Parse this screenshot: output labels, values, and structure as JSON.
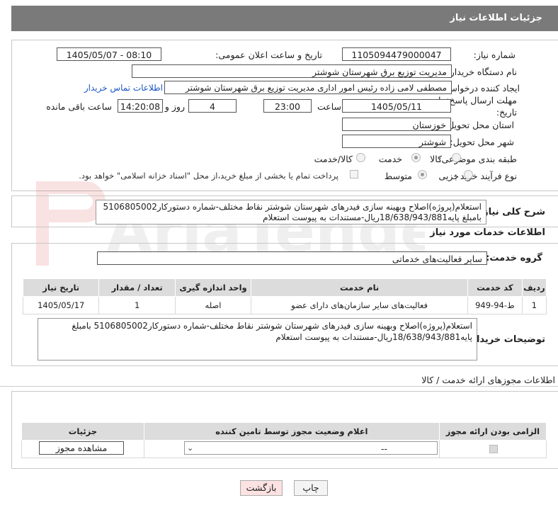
{
  "header": {
    "title": "جزئیات اطلاعات نیاز"
  },
  "form": {
    "need_number_label": "شماره نیاز:",
    "need_number": "1105094479000047",
    "announce_datetime_label": "تاریخ و ساعت اعلان عمومی:",
    "announce_datetime": "1405/05/07 - 08:10",
    "buyer_org_label": "نام دستگاه خریدار:",
    "buyer_org": "مدیریت توزیع برق شهرستان شوشتر",
    "creator_label": "ایجاد کننده درخواست:",
    "creator": "مصطفی  لامی زاده  رئیس امور اداری  مدیریت توزیع برق شهرستان شوشتر",
    "contact_link": "اطلاعات تماس خریدار",
    "deadline_label_1": "مهلت ارسال پاسخ: تا",
    "deadline_label_2": "تاریخ:",
    "deadline_date": "1405/05/11",
    "time_label": "ساعت",
    "deadline_time": "23:00",
    "days": "4",
    "days_label": "روز و",
    "remaining_time": "14:20:08",
    "remaining_label": "ساعت باقی مانده",
    "province_label": "استان محل تحویل:",
    "province": "خوزستان",
    "city_label": "شهر محل تحویل:",
    "city": "شوشتر",
    "category_label": "طبقه بندی موضوعی:",
    "category_options": [
      "کالا",
      "خدمت",
      "کالا/خدمت"
    ],
    "category_selected": "خدمت",
    "purchase_type_label": "نوع فرآیند خرید :",
    "purchase_options": [
      "جزیی",
      "متوسط"
    ],
    "purchase_selected": "متوسط",
    "treasury_note": "پرداخت تمام یا بخشی از مبلغ خرید،از محل \"اسناد خزانه اسلامی\" خواهد بود."
  },
  "summary": {
    "label": "شرح کلی نیاز:",
    "text": "استعلام(پروژه)اصلاح وبهینه سازی فیدرهای شهرستان شوشتر نقاط مختلف-شماره دستورکار5106805002 بامبلغ پایه18/638/943/881ریال-مستندات به پیوست استعلام"
  },
  "services": {
    "section_title": "اطلاعات خدمات مورد نیاز",
    "group_label": "گروه خدمت:",
    "group_value": "سایر فعالیت‌های خدماتی",
    "columns": [
      "ردیف",
      "کد خدمت",
      "نام خدمت",
      "واحد اندازه گیری",
      "تعداد / مقدار",
      "تاریخ نیاز"
    ],
    "rows": [
      {
        "row": "1",
        "code": "ط-94-949",
        "name": "فعالیت‌های سایر سازمان‌های دارای عضو",
        "unit": "اصله",
        "qty": "1",
        "date": "1405/05/17"
      }
    ]
  },
  "buyer_notes": {
    "label": "توضیحات خریدار:",
    "text": "استعلام(پروژه)اصلاح وبهینه سازی فیدرهای شهرستان شوشتر نقاط مختلف-شماره دستورکار5106805002 بامبلغ پایه18/638/943/881ریال-مستندات به پیوست استعلام"
  },
  "permits": {
    "section_title": "اطلاعات مجوزهای ارائه خدمت / کالا",
    "columns": [
      "الزامی بودن ارائه مجوز",
      "اعلام وضعیت مجوز توسط تامین کننده",
      "جزئیات"
    ],
    "select_value": "--",
    "view_button": "مشاهده مجوز"
  },
  "footer": {
    "print_button": "چاپ",
    "back_button": "بازگشت"
  },
  "watermark": {
    "text": "AriaTender.net"
  },
  "colors": {
    "header_bg": "#7a7a7a",
    "link": "#1a56c4",
    "back_button_bg": "#fde2e2"
  }
}
